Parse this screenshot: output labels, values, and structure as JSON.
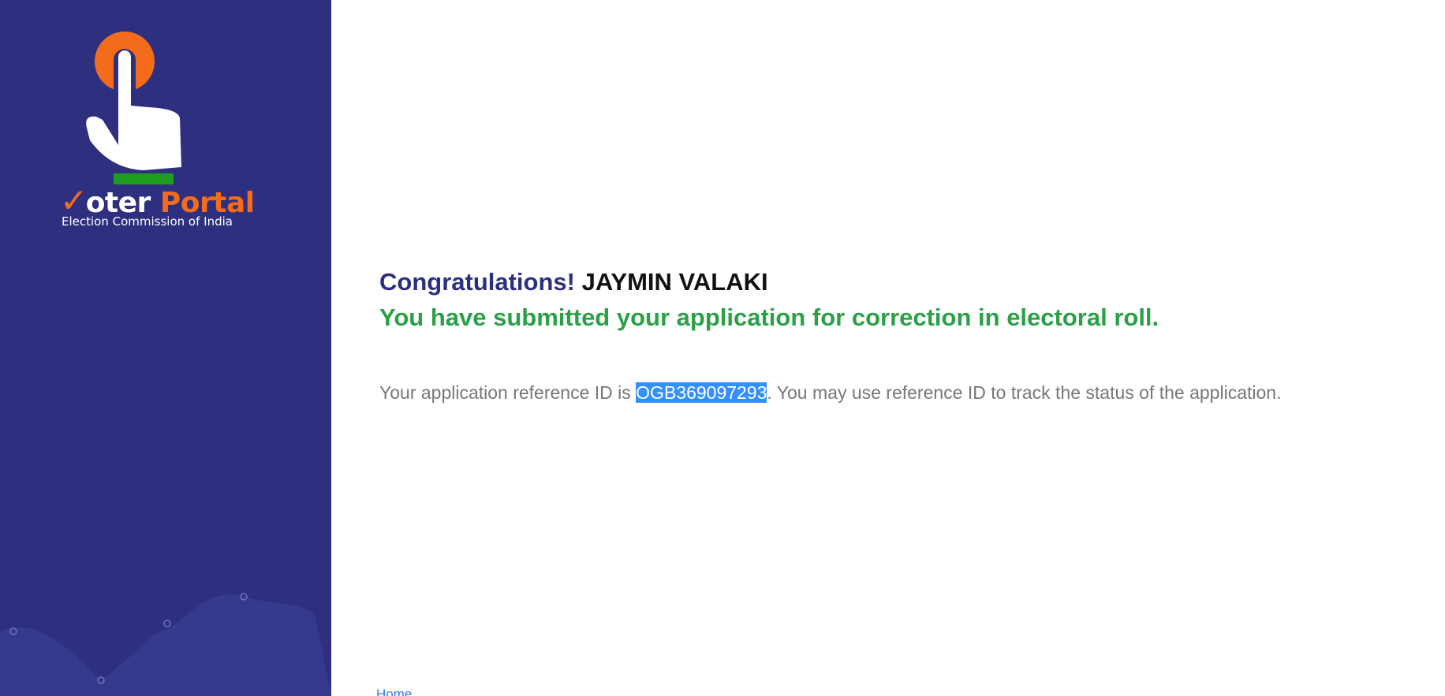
{
  "sidebar": {
    "logo": {
      "check": "✓",
      "word_voter": "oter",
      "word_portal": "Portal",
      "subtitle": "Election Commission of India"
    },
    "colors": {
      "background": "#2e2f7f",
      "accent": "#f36c1b",
      "green": "#1e9e1e"
    }
  },
  "main": {
    "congrats_label": "Congratulations!",
    "applicant_name": "JAYMIN VALAKI",
    "success_message": "You have submitted your application for correction in electoral roll.",
    "ref_prefix": "Your application reference ID is ",
    "ref_id": "OGB369097293",
    "ref_suffix": ". You may use reference ID to track the status of the application.",
    "home_link": "Home",
    "colors": {
      "heading": "#2e2f7f",
      "success": "#2aa047",
      "text": "#777777",
      "selection": "#3390ff",
      "link": "#2f80ed"
    }
  }
}
